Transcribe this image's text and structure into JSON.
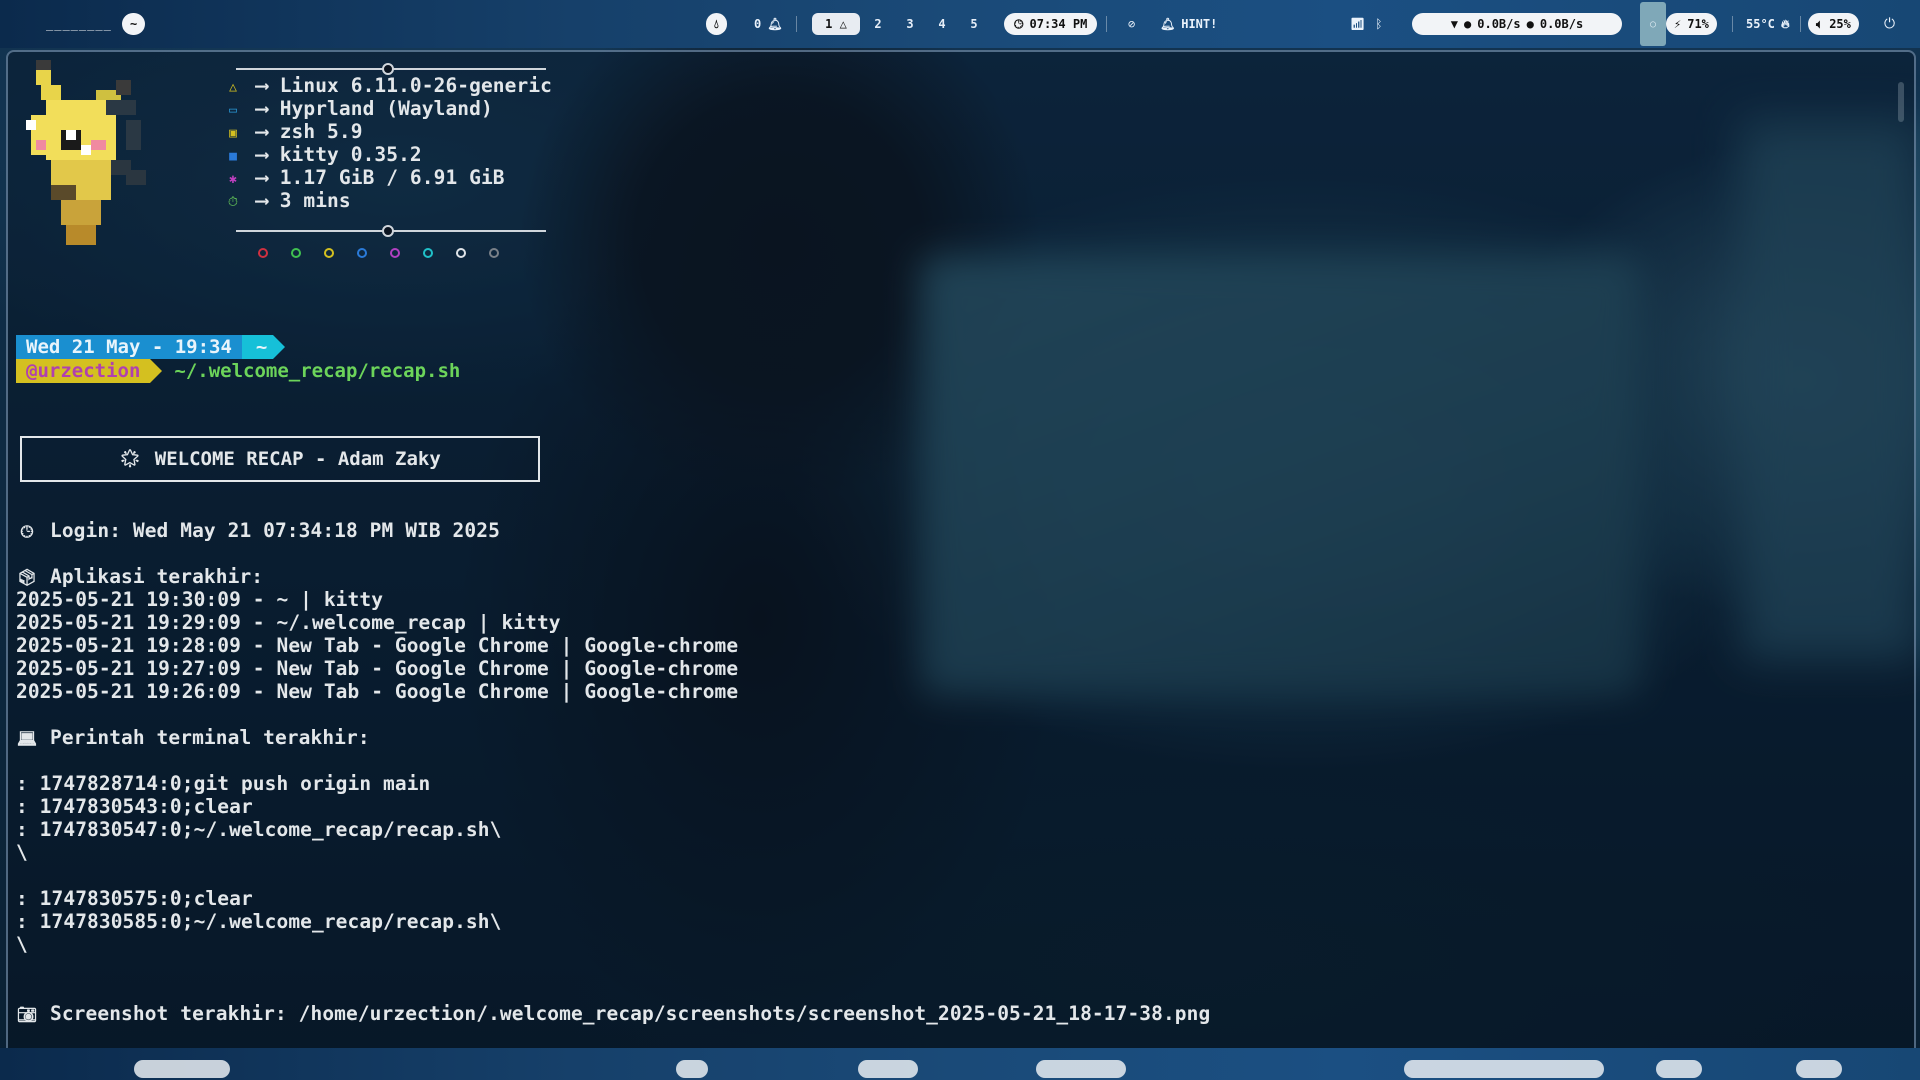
{
  "topbar": {
    "workspace_label": "________",
    "menu_button": "~",
    "notif_count": "0",
    "workspaces": [
      "1",
      "2",
      "3",
      "4",
      "5"
    ],
    "active_workspace_icon": "△",
    "clock": "07:34 PM",
    "hint": "HINT!",
    "net_down": "0.0B/s",
    "net_up": "0.0B/s",
    "battery": "71%",
    "temperature": "55°C",
    "volume": "25%"
  },
  "fetch": {
    "kernel": "Linux 6.11.0-26-generic",
    "wm": "Hyprland (Wayland)",
    "shell": "zsh 5.9",
    "terminal": "kitty 0.35.2",
    "memory": "1.17 GiB / 6.91 GiB",
    "uptime": "3 mins",
    "arrow": "⟶"
  },
  "prompt": {
    "datetime": "Wed 21 May - 19:34",
    "cwd": "~",
    "user": "@urzection",
    "command": "~/.welcome_recap/recap.sh"
  },
  "recap": {
    "title": "WELCOME RECAP - Adam Zaky",
    "login": "Login: Wed May 21 07:34:18 PM WIB 2025",
    "apps_header": "Aplikasi terakhir:",
    "apps": [
      "2025-05-21 19:30:09 - ~ | kitty",
      "2025-05-21 19:29:09 - ~/.welcome_recap | kitty",
      "2025-05-21 19:28:09 - New Tab - Google Chrome | Google-chrome",
      "2025-05-21 19:27:09 - New Tab - Google Chrome | Google-chrome",
      "2025-05-21 19:26:09 - New Tab - Google Chrome | Google-chrome"
    ],
    "cmds_header": "Perintah terminal terakhir:",
    "cmds": [
      ": 1747828714:0;git push origin main",
      ": 1747830543:0;clear",
      ": 1747830547:0;~/.welcome_recap/recap.sh\\",
      "\\",
      "",
      ": 1747830575:0;clear",
      ": 1747830585:0;~/.welcome_recap/recap.sh\\",
      "\\"
    ],
    "screenshot": "Screenshot terakhir: /home/urzection/.welcome_recap/screenshots/screenshot_2025-05-21_18-17-38.png"
  },
  "colors": {
    "prompt_date_bg": "#1a8fd0",
    "prompt_cwd_bg": "#16c0d8",
    "prompt_user_bg": "#d4c020",
    "prompt_user_fg": "#b040b0",
    "command_fg": "#6cd45a",
    "text": "#e3e7ea"
  }
}
